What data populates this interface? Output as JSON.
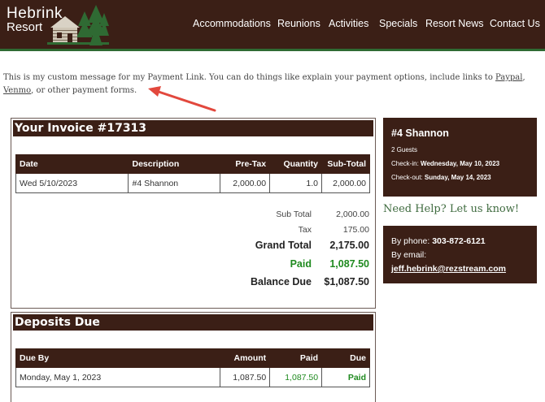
{
  "header": {
    "logo_line1": "Hebrink",
    "logo_line2": "Resort",
    "nav": [
      "Accommodations",
      "Reunions",
      "Activities",
      "Specials",
      "Resort News",
      "Contact Us"
    ]
  },
  "message": {
    "text1": "This is my custom message for my Payment Link.  You can do things like explain your payment options, include links to ",
    "link1": "Paypal",
    "sep1": ", ",
    "link2": "Venmo",
    "text2": ", or other payment forms."
  },
  "invoice": {
    "title": "Your Invoice #17313",
    "columns": [
      "Date",
      "Description",
      "Pre-Tax",
      "Quantity",
      "Sub-Total"
    ],
    "rows": [
      {
        "date": "Wed 5/10/2023",
        "description": "#4 Shannon",
        "pretax": "2,000.00",
        "quantity": "1.0",
        "subtotal": "2,000.00"
      }
    ],
    "subtotal_label": "Sub Total",
    "subtotal_value": "2,000.00",
    "tax_label": "Tax",
    "tax_value": "175.00",
    "grand_label": "Grand Total",
    "grand_value": "2,175.00",
    "paid_label": "Paid",
    "paid_value": "1,087.50",
    "balance_label": "Balance Due",
    "balance_value": "$1,087.50"
  },
  "deposits": {
    "title": "Deposits Due",
    "columns": [
      "Due By",
      "Amount",
      "Paid",
      "Due"
    ],
    "rows": [
      {
        "due_by": "Monday, May 1, 2023",
        "amount": "1,087.50",
        "paid": "1,087.50",
        "due": "Paid"
      }
    ]
  },
  "booking": {
    "unit": "#4 Shannon",
    "guests": "2 Guests",
    "checkin_label": "Check-in:",
    "checkin_value": "Wednesday, May 10, 2023",
    "checkout_label": "Check-out:",
    "checkout_value": "Sunday, May 14, 2023"
  },
  "help": {
    "heading": "Need Help? Let us know!",
    "phone_label": "By phone:",
    "phone_value": "303-872-6121",
    "email_label": "By email:",
    "email_value": "jeff.hebrink@rezstream.com"
  },
  "colors": {
    "brand_brown": "#3b1f16",
    "accent_green": "#2f6a33",
    "paid_green": "#1f8a1f",
    "arrow_red": "#e2483d"
  }
}
